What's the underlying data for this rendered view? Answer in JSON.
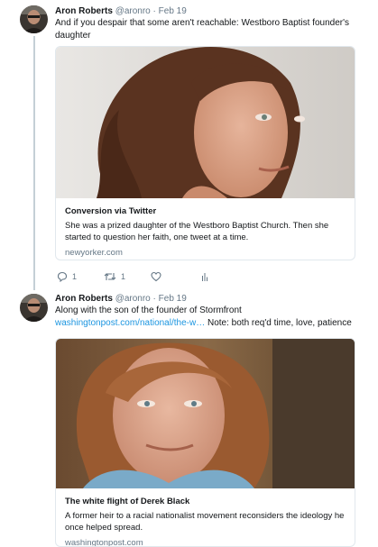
{
  "colors": {
    "accent": "#1b95e0",
    "secondary_text": "#657786",
    "thread_line": "#c4cfd6",
    "border": "#e1e8ed"
  },
  "tweets": [
    {
      "author_name": "Aron Roberts",
      "handle": "@aronro",
      "separator": "·",
      "date": "Feb 19",
      "text": "And if you despair that some aren't reachable: Westboro Baptist founder's daughter",
      "card": {
        "image": "portrait-woman-red-curly-hair",
        "title": "Conversion via Twitter",
        "description": "She was a prized daughter of the Westboro Baptist Church. Then she started to question her faith, one tweet at a time.",
        "domain": "newyorker.com"
      },
      "actions": {
        "reply_icon": "reply-icon",
        "reply_count": "1",
        "retweet_icon": "retweet-icon",
        "retweet_count": "1",
        "like_icon": "heart-icon",
        "stats_icon": "analytics-icon"
      }
    },
    {
      "author_name": "Aron Roberts",
      "handle": "@aronro",
      "separator": "·",
      "date": "Feb 19",
      "text_before_link": "Along with the son of the founder of Stormfront ",
      "link_text": "washingtonpost.com/national/the-w…",
      "text_after_link": " Note: both req'd time, love, patience",
      "card": {
        "image": "portrait-young-man-reddish-hair",
        "title": "The white flight of Derek Black",
        "description": "A former heir to a racial nationalist movement reconsiders the ideology he once helped spread.",
        "domain": "washingtonpost.com"
      }
    }
  ]
}
